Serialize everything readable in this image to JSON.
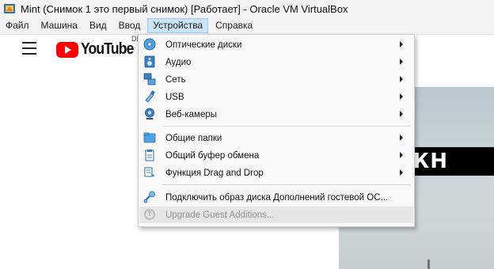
{
  "window": {
    "title": "Mint (Снимок 1 это первый снимок) [Работает] - Oracle VM VirtualBox"
  },
  "menubar": {
    "items": [
      {
        "label": "Файл"
      },
      {
        "label": "Машина"
      },
      {
        "label": "Вид"
      },
      {
        "label": "Ввод"
      },
      {
        "label": "Устройства"
      },
      {
        "label": "Справка"
      }
    ],
    "active": "Устройства"
  },
  "guest": {
    "youtube_logo_text": "YouTube",
    "youtube_country_code": "DE",
    "video_caption": "БЕРЕЖН"
  },
  "devices_menu": {
    "items": [
      {
        "label": "Оптические диски",
        "icon": "optical-disc-icon",
        "submenu": true
      },
      {
        "label": "Аудио",
        "icon": "audio-icon",
        "submenu": true
      },
      {
        "label": "Сеть",
        "icon": "network-icon",
        "submenu": true
      },
      {
        "label": "USB",
        "icon": "usb-icon",
        "submenu": true
      },
      {
        "label": "Веб-камеры",
        "icon": "webcam-icon",
        "submenu": true
      },
      {
        "label": "Общие папки",
        "icon": "shared-folder-icon",
        "submenu": true
      },
      {
        "label": "Общий буфер обмена",
        "icon": "clipboard-icon",
        "submenu": true
      },
      {
        "label": "Функция Drag and Drop",
        "icon": "drag-drop-icon",
        "submenu": true
      },
      {
        "label": "Подключить образ диска Дополнений гостевой ОС...",
        "icon": "guest-additions-disk-icon",
        "submenu": false
      },
      {
        "label": "Upgrade Guest Additions...",
        "icon": "upgrade-guest-additions-icon",
        "submenu": false,
        "disabled": true
      }
    ]
  },
  "colors": {
    "menubar_bg": "#f3f3f3",
    "active_menu_bg": "#cce4f7",
    "youtube_red": "#ff0000",
    "disabled_text": "#8e8e8e"
  }
}
